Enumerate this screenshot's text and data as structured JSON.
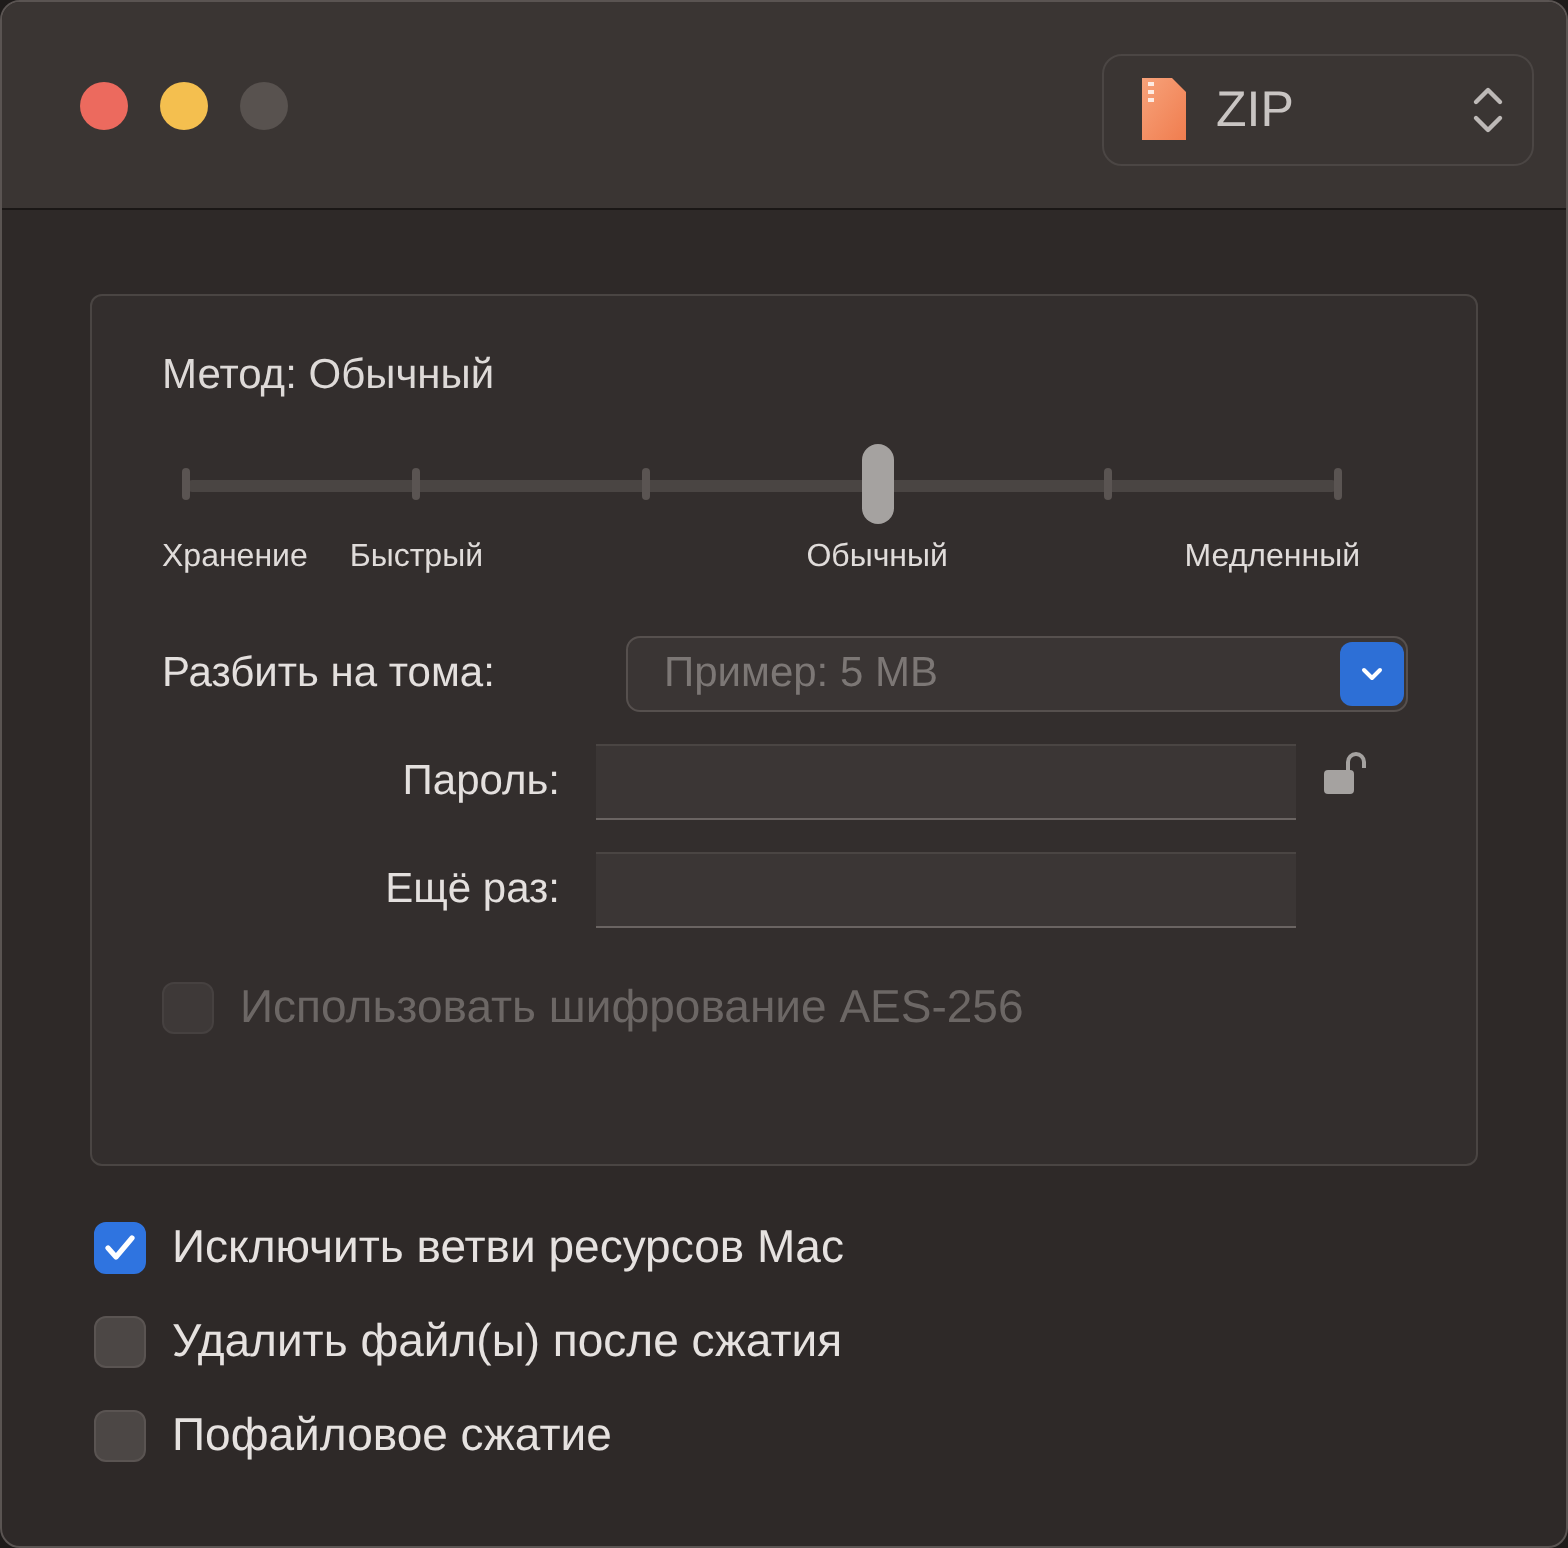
{
  "format_picker": {
    "value": "ZIP"
  },
  "method": {
    "label": "Метод: Обычный",
    "slider": {
      "level": 0.6,
      "stops": [
        {
          "kind": "labeled",
          "label": "Хранение"
        },
        {
          "kind": "labeled",
          "label": "Быстрый"
        },
        {
          "kind": "plain"
        },
        {
          "kind": "labeled",
          "label": "Обычный"
        },
        {
          "kind": "plain"
        },
        {
          "kind": "labeled",
          "label": "Медленный"
        }
      ]
    }
  },
  "split": {
    "label": "Разбить на тома:",
    "placeholder": "Пример: 5 MB"
  },
  "password": {
    "label": "Пароль:",
    "locked": false
  },
  "repeat": {
    "label": "Ещё раз:"
  },
  "encryption": {
    "label": "Использовать шифрование AES-256",
    "checked": false,
    "disabled": true
  },
  "options": [
    {
      "label": "Исключить ветви ресурсов Mac",
      "checked": true
    },
    {
      "label": "Удалить файл(ы) после сжатия",
      "checked": false
    },
    {
      "label": "Пофайловое сжатие",
      "checked": false
    }
  ]
}
